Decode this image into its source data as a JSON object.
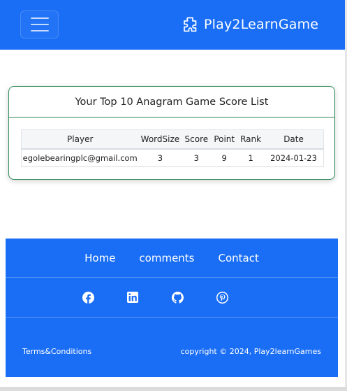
{
  "navbar": {
    "brand": "Play2LearnGame",
    "bg_color": "#1a6ef5",
    "toggler_icon": "hamburger-menu-icon",
    "brand_icon": "puzzle-piece-icon"
  },
  "scores": {
    "title": "Your Top 10 Anagram Game Score List",
    "border_color": "#2e8b57",
    "columns": [
      "Player",
      "WordSize",
      "Score",
      "Point",
      "Rank",
      "Date"
    ],
    "rows": [
      [
        "egolebearingplc@gmail.com",
        "3",
        "3",
        "9",
        "1",
        "2024-01-23"
      ]
    ]
  },
  "footer": {
    "links": [
      "Home",
      "comments",
      "Contact"
    ],
    "social_icons": [
      "facebook-icon",
      "linkedin-icon",
      "github-icon",
      "pinterest-icon"
    ],
    "terms": "Terms&Conditions",
    "copyright": "copyright © 2024, Play2learnGames"
  }
}
